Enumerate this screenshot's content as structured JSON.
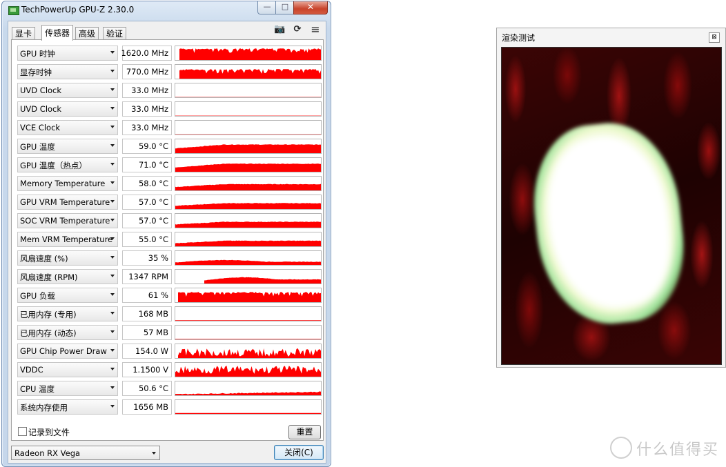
{
  "window": {
    "title": "TechPowerUp GPU-Z 2.30.0",
    "minimize_label": "—",
    "maximize_label": "□",
    "close_label": "✕"
  },
  "tabs": [
    {
      "label": "显卡",
      "active": false
    },
    {
      "label": "传感器",
      "active": true
    },
    {
      "label": "高级",
      "active": false
    },
    {
      "label": "验证",
      "active": false
    }
  ],
  "toolbar": {
    "camera_glyph": "📷",
    "refresh_glyph": "⟳",
    "menu_glyph": "≡"
  },
  "sensors": [
    {
      "name": "GPU 时钟",
      "value": "1620.0 MHz",
      "graph": {
        "style": "noisy-full",
        "level": 0.85,
        "start": 0.03
      }
    },
    {
      "name": "显存时钟",
      "value": "770.0 MHz",
      "graph": {
        "style": "noisy-full",
        "level": 0.7,
        "start": 0.03
      }
    },
    {
      "name": "UVD Clock",
      "value": "33.0 MHz",
      "graph": {
        "style": "flat",
        "level": 0.02,
        "start": 0.0
      }
    },
    {
      "name": "UVD Clock",
      "value": "33.0 MHz",
      "graph": {
        "style": "flat",
        "level": 0.02,
        "start": 0.0
      }
    },
    {
      "name": "VCE Clock",
      "value": "33.0 MHz",
      "graph": {
        "style": "flat",
        "level": 0.02,
        "start": 0.0
      }
    },
    {
      "name": "GPU 温度",
      "value": "59.0 °C",
      "graph": {
        "style": "ramp",
        "level": 0.62,
        "start": 0.0
      }
    },
    {
      "name": "GPU 温度（热点）",
      "value": "71.0 °C",
      "graph": {
        "style": "ramp",
        "level": 0.58,
        "start": 0.0
      }
    },
    {
      "name": "Memory Temperature",
      "value": "58.0 °C",
      "graph": {
        "style": "ramp",
        "level": 0.45,
        "start": 0.0
      }
    },
    {
      "name": "GPU VRM Temperature",
      "value": "57.0 °C",
      "graph": {
        "style": "ramp",
        "level": 0.42,
        "start": 0.0
      }
    },
    {
      "name": "SOC VRM Temperature",
      "value": "57.0 °C",
      "graph": {
        "style": "ramp",
        "level": 0.42,
        "start": 0.0
      }
    },
    {
      "name": "Mem VRM Temperature",
      "value": "55.0 °C",
      "graph": {
        "style": "ramp",
        "level": 0.4,
        "start": 0.0
      }
    },
    {
      "name": "风扇速度 (%)",
      "value": "35 %",
      "graph": {
        "style": "hump",
        "level": 0.35,
        "start": 0.0
      }
    },
    {
      "name": "风扇速度 (RPM)",
      "value": "1347 RPM",
      "graph": {
        "style": "hump",
        "level": 0.45,
        "start": 0.2
      }
    },
    {
      "name": "GPU 负载",
      "value": "61 %",
      "graph": {
        "style": "noisy-full",
        "level": 0.75,
        "start": 0.02
      }
    },
    {
      "name": "已用内存 (专用)",
      "value": "168 MB",
      "graph": {
        "style": "flat",
        "level": 0.04,
        "start": 0.0
      }
    },
    {
      "name": "已用内存 (动态)",
      "value": "57 MB",
      "graph": {
        "style": "flat",
        "level": 0.03,
        "start": 0.0
      }
    },
    {
      "name": "GPU Chip Power Draw",
      "value": "154.0 W",
      "graph": {
        "style": "spiky",
        "level": 0.7,
        "start": 0.02
      }
    },
    {
      "name": "VDDC",
      "value": "1.1500 V",
      "graph": {
        "style": "spiky",
        "level": 0.8,
        "start": 0.0
      }
    },
    {
      "name": "CPU 温度",
      "value": "50.6 °C",
      "graph": {
        "style": "low-noisy",
        "level": 0.25,
        "start": 0.0
      }
    },
    {
      "name": "系统内存使用",
      "value": "1656 MB",
      "graph": {
        "style": "flat",
        "level": 0.06,
        "start": 0.0
      }
    }
  ],
  "footer": {
    "log_checkbox_label": "记录到文件",
    "log_checked": false,
    "reset_label": "重置",
    "gpu_select_value": "Radeon RX Vega",
    "close_label": "关闭(C)"
  },
  "render_window": {
    "title": "渲染测试",
    "close_glyph": "⊠"
  },
  "watermark": {
    "text": "什么值得买"
  },
  "colors": {
    "graph_red": "#ff0000",
    "accent_blue": "#3c7fb1"
  }
}
